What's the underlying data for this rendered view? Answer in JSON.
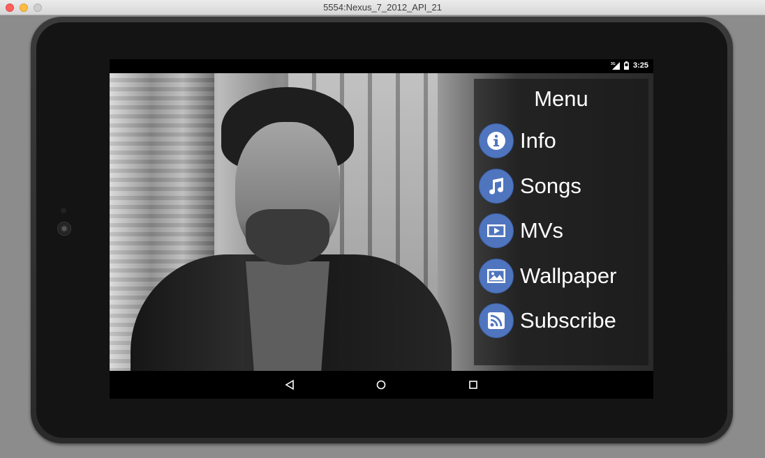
{
  "window": {
    "title": "5554:Nexus_7_2012_API_21"
  },
  "status_bar": {
    "network_label": "3G",
    "time": "3:25",
    "icons": [
      "signal-icon",
      "battery-icon"
    ]
  },
  "menu": {
    "title": "Menu",
    "accent_color": "#4f75bf",
    "items": [
      {
        "label": "Info",
        "icon": "info-icon"
      },
      {
        "label": "Songs",
        "icon": "music-note-icon"
      },
      {
        "label": "MVs",
        "icon": "video-play-icon"
      },
      {
        "label": "Wallpaper",
        "icon": "image-icon"
      },
      {
        "label": "Subscribe",
        "icon": "rss-icon"
      }
    ]
  },
  "nav_bar": {
    "buttons": [
      "back-icon",
      "home-icon",
      "recent-apps-icon"
    ]
  }
}
